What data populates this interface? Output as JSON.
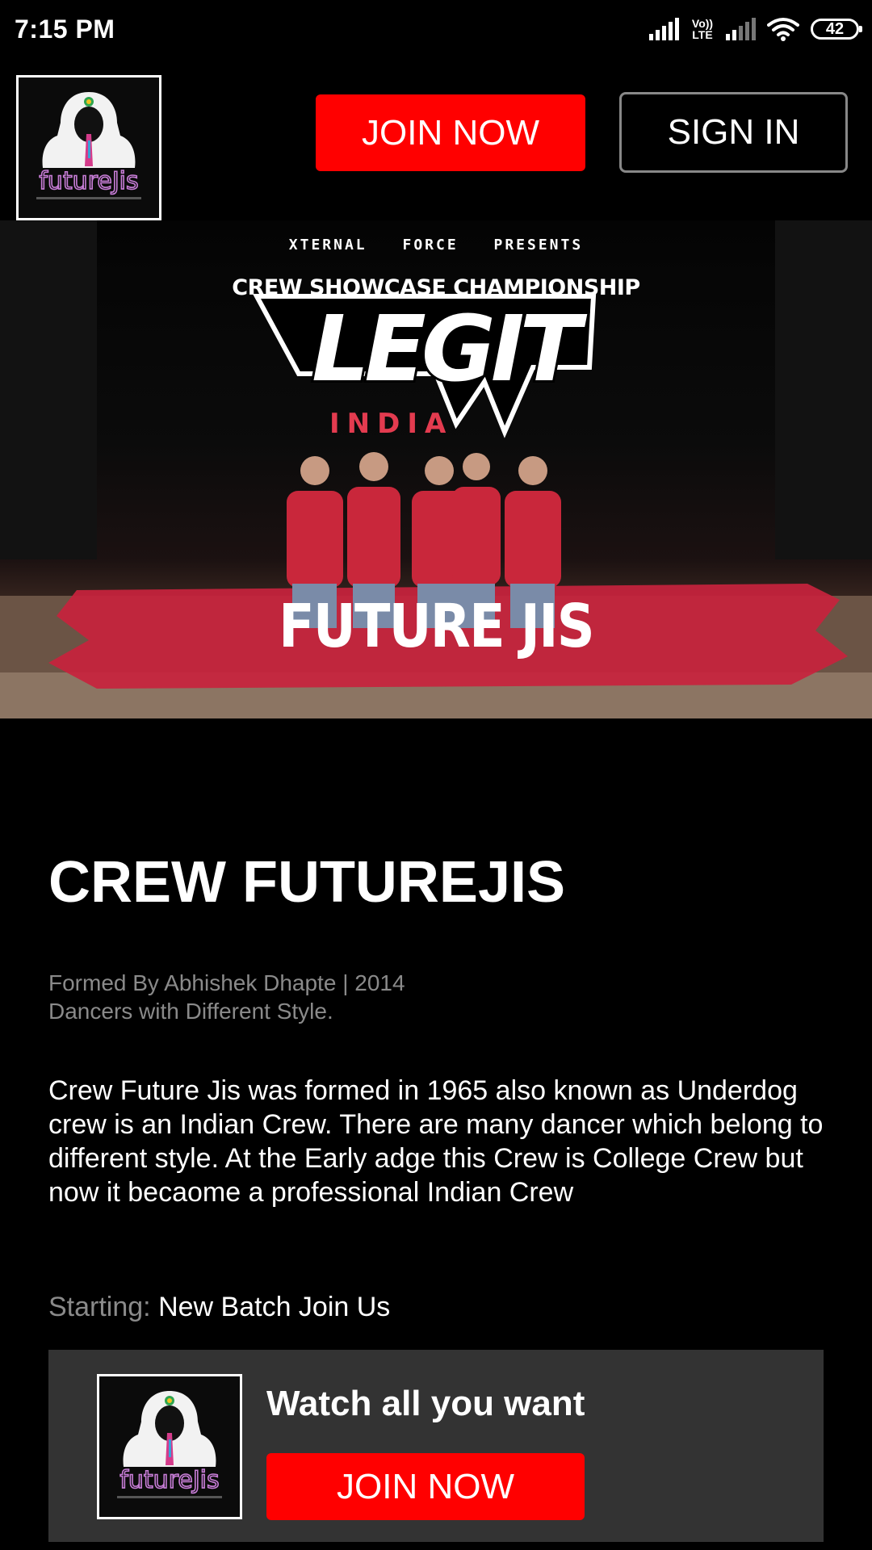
{
  "status_bar": {
    "time": "7:15 PM",
    "volte": "Vo)) LTE",
    "battery": "42"
  },
  "header": {
    "logo_icon": "futurejis-logo",
    "join_label": "JOIN NOW",
    "signin_label": "SIGN IN"
  },
  "hero": {
    "presents_line": "XTERNAL FORCE PRESENTS",
    "championship": "CREW SHOWCASE CHAMPIONSHIP",
    "legit": "LEGIT",
    "india": "INDIA",
    "crew_banner": "FUTURE JIS"
  },
  "content": {
    "title": "CREW FUTUREJIS",
    "formed_by": "Formed By Abhishek Dhapte | 2014",
    "tagline": "Dancers with Different Style.",
    "description": "Crew Future Jis was formed in 1965 also known as Underdog crew is an Indian Crew. There are many dancer which belong to different style. At the Early adge this Crew is College Crew but now it becaome a professional Indian Crew",
    "starting_label": "Starting:",
    "starting_value": "New Batch Join Us"
  },
  "card": {
    "heading": "Watch all you want",
    "join_label": "JOIN NOW"
  },
  "colors": {
    "accent": "#ff0000",
    "card_bg": "#333333",
    "muted_text": "#8a8a8a",
    "banner_red": "#c8233d"
  }
}
